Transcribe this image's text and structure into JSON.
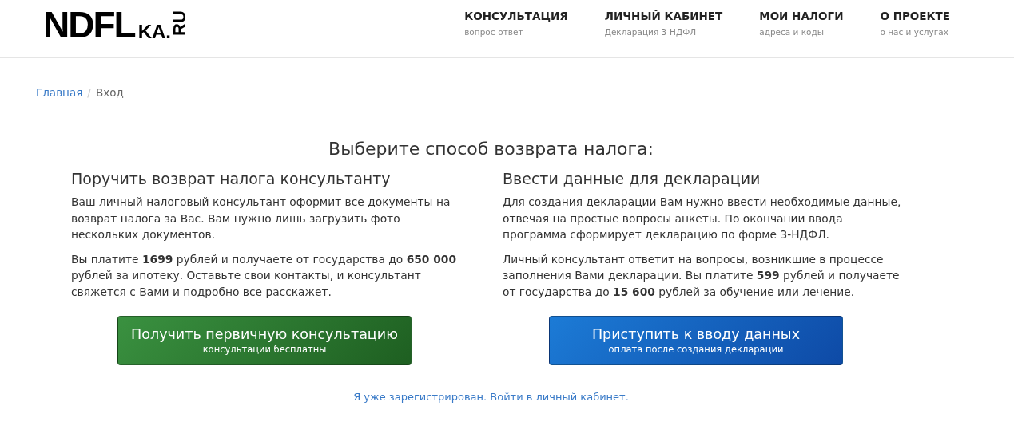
{
  "logo": {
    "main": "NDFL",
    "suffix": "KA.",
    "domain": "RU"
  },
  "nav": [
    {
      "title": "КОНСУЛЬТАЦИЯ",
      "subtitle": "вопрос-ответ"
    },
    {
      "title": "ЛИЧНЫЙ КАБИНЕТ",
      "subtitle": "Декларация 3-НДФЛ"
    },
    {
      "title": "МОИ НАЛОГИ",
      "subtitle": "адреса и коды"
    },
    {
      "title": "О ПРОЕКТЕ",
      "subtitle": "о нас и услугах"
    }
  ],
  "breadcrumb": {
    "items": [
      "Главная",
      "Вход"
    ],
    "separator": "/"
  },
  "heading": "Выберите способ возврата налога:",
  "options": [
    {
      "title": "Поручить возврат налога консультанту",
      "paragraphs": [
        "Ваш личный налоговый консультант оформит все документы на возврат налога за Вас. Вам нужно лишь загрузить фото нескольких документов.",
        "Вы платите **1699** рублей и получаете от государства до **650 000** рублей за ипотеку. Оставьте свои контакты, и консультант свяжется с Вами и подробно все расскажет."
      ],
      "button": {
        "kind": "green",
        "label": "Получить первичную консультацию",
        "note": "консультации бесплатны"
      }
    },
    {
      "title": "Ввести данные для декларации",
      "paragraphs": [
        "Для создания декларации Вам нужно ввести необходимые данные, отвечая на простые вопросы анкеты. По окончании ввода программа сформирует декларацию по форме 3-НДФЛ.",
        "Личный консультант ответит на вопросы, возникшие в процессе заполнения Вами декларации. Вы платите **599** рублей и получаете от государства до **15 600** рублей за обучение или лечение."
      ],
      "button": {
        "kind": "blue",
        "label": "Приступить к вводу данных",
        "note": "оплата после создания декларации"
      }
    }
  ],
  "login_link": "Я уже зарегистрирован. Войти в личный кабинет."
}
